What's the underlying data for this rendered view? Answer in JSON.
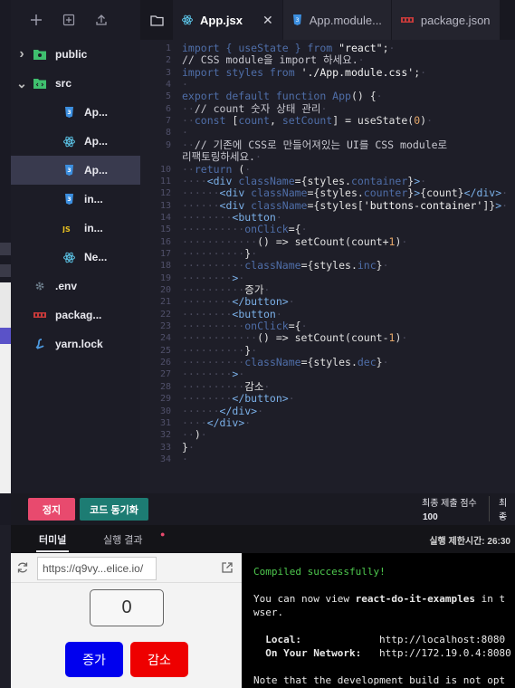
{
  "sidebar": {
    "tree": [
      {
        "label": "public",
        "icon": "folder-public-icon",
        "indent": 0,
        "expander": "closed"
      },
      {
        "label": "src",
        "icon": "folder-src-icon",
        "indent": 0,
        "expander": "open"
      },
      {
        "label": "Ap...",
        "icon": "css-file-icon",
        "indent": 1
      },
      {
        "label": "Ap...",
        "icon": "react-file-icon",
        "indent": 1
      },
      {
        "label": "Ap...",
        "icon": "css-file-icon",
        "indent": 1,
        "selected": true
      },
      {
        "label": "in...",
        "icon": "css-file-icon",
        "indent": 1
      },
      {
        "label": "in...",
        "icon": "js-file-icon",
        "indent": 1
      },
      {
        "label": "Ne...",
        "icon": "react-file-icon",
        "indent": 1
      },
      {
        "label": ".env",
        "icon": "gear-file-icon",
        "indent": 0
      },
      {
        "label": "packag...",
        "icon": "npm-file-icon",
        "indent": 0
      },
      {
        "label": "yarn.lock",
        "icon": "yarn-file-icon",
        "indent": 0
      }
    ]
  },
  "editor": {
    "tabs": [
      {
        "label": "App.jsx",
        "icon": "react-file-icon",
        "active": true
      },
      {
        "label": "App.module...",
        "icon": "css-file-icon"
      },
      {
        "label": "package.json",
        "icon": "npm-file-icon"
      }
    ],
    "code_lines": [
      {
        "n": "1",
        "parts": [
          [
            "kw",
            "import "
          ],
          [
            "kw",
            "{ "
          ],
          [
            "kw",
            "useState "
          ],
          [
            "kw",
            "} "
          ],
          [
            "kw",
            "from "
          ],
          [
            "str",
            "\"react\""
          ],
          [
            "txt",
            ";"
          ],
          [
            "ws",
            "·"
          ]
        ]
      },
      {
        "n": "2",
        "parts": [
          [
            "cm",
            "// CSS module을 import 하세요."
          ],
          [
            "ws",
            "·"
          ]
        ]
      },
      {
        "n": "3",
        "parts": [
          [
            "kw",
            "import styles from "
          ],
          [
            "str",
            "'./App.module.css'"
          ],
          [
            "txt",
            ";"
          ],
          [
            "ws",
            "·"
          ]
        ]
      },
      {
        "n": "4",
        "parts": [
          [
            "ws",
            "·"
          ]
        ]
      },
      {
        "n": "5",
        "parts": [
          [
            "kw",
            "export default function App"
          ],
          [
            "txt",
            "() {"
          ],
          [
            "ws",
            "·"
          ]
        ]
      },
      {
        "n": "6",
        "parts": [
          [
            "ws",
            "··"
          ],
          [
            "cm",
            "// count 숫자 상태 관리"
          ],
          [
            "ws",
            "·"
          ]
        ]
      },
      {
        "n": "7",
        "parts": [
          [
            "ws",
            "··"
          ],
          [
            "kw",
            "const "
          ],
          [
            "txt",
            "["
          ],
          [
            "kw",
            "count"
          ],
          [
            "txt",
            ", "
          ],
          [
            "kw",
            "setCount"
          ],
          [
            "txt",
            "] = useState("
          ],
          [
            "num",
            "0"
          ],
          [
            "txt",
            ")"
          ],
          [
            "ws",
            "·"
          ]
        ]
      },
      {
        "n": "8",
        "parts": [
          [
            "ws",
            "·"
          ]
        ]
      },
      {
        "n": "9",
        "parts": [
          [
            "ws",
            "··"
          ],
          [
            "cm",
            "// 기존에 CSS로 만들어져있는 UI를 CSS module로"
          ]
        ]
      },
      {
        "n": "",
        "parts": [
          [
            "cm",
            "리팩토링하세요."
          ],
          [
            "ws",
            "·"
          ]
        ]
      },
      {
        "n": "10",
        "parts": [
          [
            "ws",
            "··"
          ],
          [
            "kw",
            "return "
          ],
          [
            "txt",
            "("
          ],
          [
            "ws",
            "·"
          ]
        ]
      },
      {
        "n": "11",
        "parts": [
          [
            "ws",
            "····"
          ],
          [
            "id",
            "<div "
          ],
          [
            "kw",
            "className"
          ],
          [
            "txt",
            "={styles."
          ],
          [
            "kw",
            "container"
          ],
          [
            "txt",
            "}"
          ],
          [
            "id",
            ">"
          ],
          [
            "ws",
            "·"
          ]
        ]
      },
      {
        "n": "12",
        "parts": [
          [
            "ws",
            "······"
          ],
          [
            "id",
            "<div "
          ],
          [
            "kw",
            "className"
          ],
          [
            "txt",
            "={styles."
          ],
          [
            "kw",
            "counter"
          ],
          [
            "txt",
            "}"
          ],
          [
            "id",
            ">"
          ],
          [
            "txt",
            "{count}"
          ],
          [
            "id",
            "</div>"
          ],
          [
            "ws",
            "·"
          ]
        ]
      },
      {
        "n": "13",
        "parts": [
          [
            "ws",
            "······"
          ],
          [
            "id",
            "<div "
          ],
          [
            "kw",
            "className"
          ],
          [
            "txt",
            "={styles["
          ],
          [
            "str",
            "'buttons-container'"
          ],
          [
            "txt",
            "]}"
          ],
          [
            "id",
            ">"
          ],
          [
            "ws",
            "·"
          ]
        ]
      },
      {
        "n": "14",
        "parts": [
          [
            "ws",
            "········"
          ],
          [
            "id",
            "<button"
          ],
          [
            "ws",
            "·"
          ]
        ]
      },
      {
        "n": "15",
        "parts": [
          [
            "ws",
            "··········"
          ],
          [
            "kw",
            "onClick"
          ],
          [
            "txt",
            "={"
          ],
          [
            "ws",
            "·"
          ]
        ]
      },
      {
        "n": "16",
        "parts": [
          [
            "ws",
            "············"
          ],
          [
            "txt",
            "() => setCount(count+"
          ],
          [
            "num",
            "1"
          ],
          [
            "txt",
            ")"
          ],
          [
            "ws",
            "·"
          ]
        ]
      },
      {
        "n": "17",
        "parts": [
          [
            "ws",
            "··········"
          ],
          [
            "txt",
            "}"
          ],
          [
            "ws",
            "·"
          ]
        ]
      },
      {
        "n": "18",
        "parts": [
          [
            "ws",
            "··········"
          ],
          [
            "kw",
            "className"
          ],
          [
            "txt",
            "={styles."
          ],
          [
            "kw",
            "inc"
          ],
          [
            "txt",
            "}"
          ],
          [
            "ws",
            "·"
          ]
        ]
      },
      {
        "n": "19",
        "parts": [
          [
            "ws",
            "········"
          ],
          [
            "id",
            ">"
          ],
          [
            "ws",
            "·"
          ]
        ]
      },
      {
        "n": "20",
        "parts": [
          [
            "ws",
            "··········"
          ],
          [
            "txt",
            "증가"
          ],
          [
            "ws",
            "·"
          ]
        ]
      },
      {
        "n": "21",
        "parts": [
          [
            "ws",
            "········"
          ],
          [
            "id",
            "</button>"
          ],
          [
            "ws",
            "·"
          ]
        ]
      },
      {
        "n": "22",
        "parts": [
          [
            "ws",
            "········"
          ],
          [
            "id",
            "<button"
          ],
          [
            "ws",
            "·"
          ]
        ]
      },
      {
        "n": "23",
        "parts": [
          [
            "ws",
            "··········"
          ],
          [
            "kw",
            "onClick"
          ],
          [
            "txt",
            "={"
          ],
          [
            "ws",
            "·"
          ]
        ]
      },
      {
        "n": "24",
        "parts": [
          [
            "ws",
            "············"
          ],
          [
            "txt",
            "() => setCount(count-"
          ],
          [
            "num",
            "1"
          ],
          [
            "txt",
            ")"
          ],
          [
            "ws",
            "·"
          ]
        ]
      },
      {
        "n": "25",
        "parts": [
          [
            "ws",
            "··········"
          ],
          [
            "txt",
            "}"
          ],
          [
            "ws",
            "·"
          ]
        ]
      },
      {
        "n": "26",
        "parts": [
          [
            "ws",
            "··········"
          ],
          [
            "kw",
            "className"
          ],
          [
            "txt",
            "={styles."
          ],
          [
            "kw",
            "dec"
          ],
          [
            "txt",
            "}"
          ],
          [
            "ws",
            "·"
          ]
        ]
      },
      {
        "n": "27",
        "parts": [
          [
            "ws",
            "········"
          ],
          [
            "id",
            ">"
          ],
          [
            "ws",
            "·"
          ]
        ]
      },
      {
        "n": "28",
        "parts": [
          [
            "ws",
            "··········"
          ],
          [
            "txt",
            "감소"
          ],
          [
            "ws",
            "·"
          ]
        ]
      },
      {
        "n": "29",
        "parts": [
          [
            "ws",
            "········"
          ],
          [
            "id",
            "</button>"
          ],
          [
            "ws",
            "·"
          ]
        ]
      },
      {
        "n": "30",
        "parts": [
          [
            "ws",
            "······"
          ],
          [
            "id",
            "</div>"
          ],
          [
            "ws",
            "·"
          ]
        ]
      },
      {
        "n": "31",
        "parts": [
          [
            "ws",
            "····"
          ],
          [
            "id",
            "</div>"
          ],
          [
            "ws",
            "·"
          ]
        ]
      },
      {
        "n": "32",
        "parts": [
          [
            "ws",
            "··"
          ],
          [
            "txt",
            ")"
          ],
          [
            "ws",
            "·"
          ]
        ]
      },
      {
        "n": "33",
        "parts": [
          [
            "txt",
            "}"
          ],
          [
            "ws",
            "·"
          ]
        ]
      },
      {
        "n": "34",
        "parts": [
          [
            "ws",
            "·"
          ]
        ]
      }
    ]
  },
  "actions": {
    "stop_label": "정지",
    "sync_label": "코드 동기화",
    "final_score_label": "최종 제출 점수",
    "final_score_value": "100",
    "final_label_2": "최종",
    "final_value_2": "–"
  },
  "bottom_tabs": {
    "terminal_label": "터미널",
    "result_label": "실행 결과",
    "time_limit": "실행 제한시간: 26:30"
  },
  "preview": {
    "url_value": "https://q9vy...elice.io/",
    "counter_value": "0",
    "inc_label": "증가",
    "dec_label": "감소"
  },
  "terminal": {
    "compiled": "Compiled successfully!",
    "line1": "You can now view ",
    "app_name": "react-do-it-examples",
    "line1_rest": " in t",
    "line2": "wser.",
    "local_label": "  Local:",
    "local_url": "http://localhost:8080",
    "network_label": "  On Your Network:",
    "network_url": "http://172.19.0.4:8080",
    "note": "Note that the development build is not opt"
  },
  "colors": {
    "stop": "#e84a6e",
    "sync": "#1d7c73",
    "inc": "#0000ee",
    "dec": "#ee0000",
    "compiled": "#4ec94e"
  }
}
